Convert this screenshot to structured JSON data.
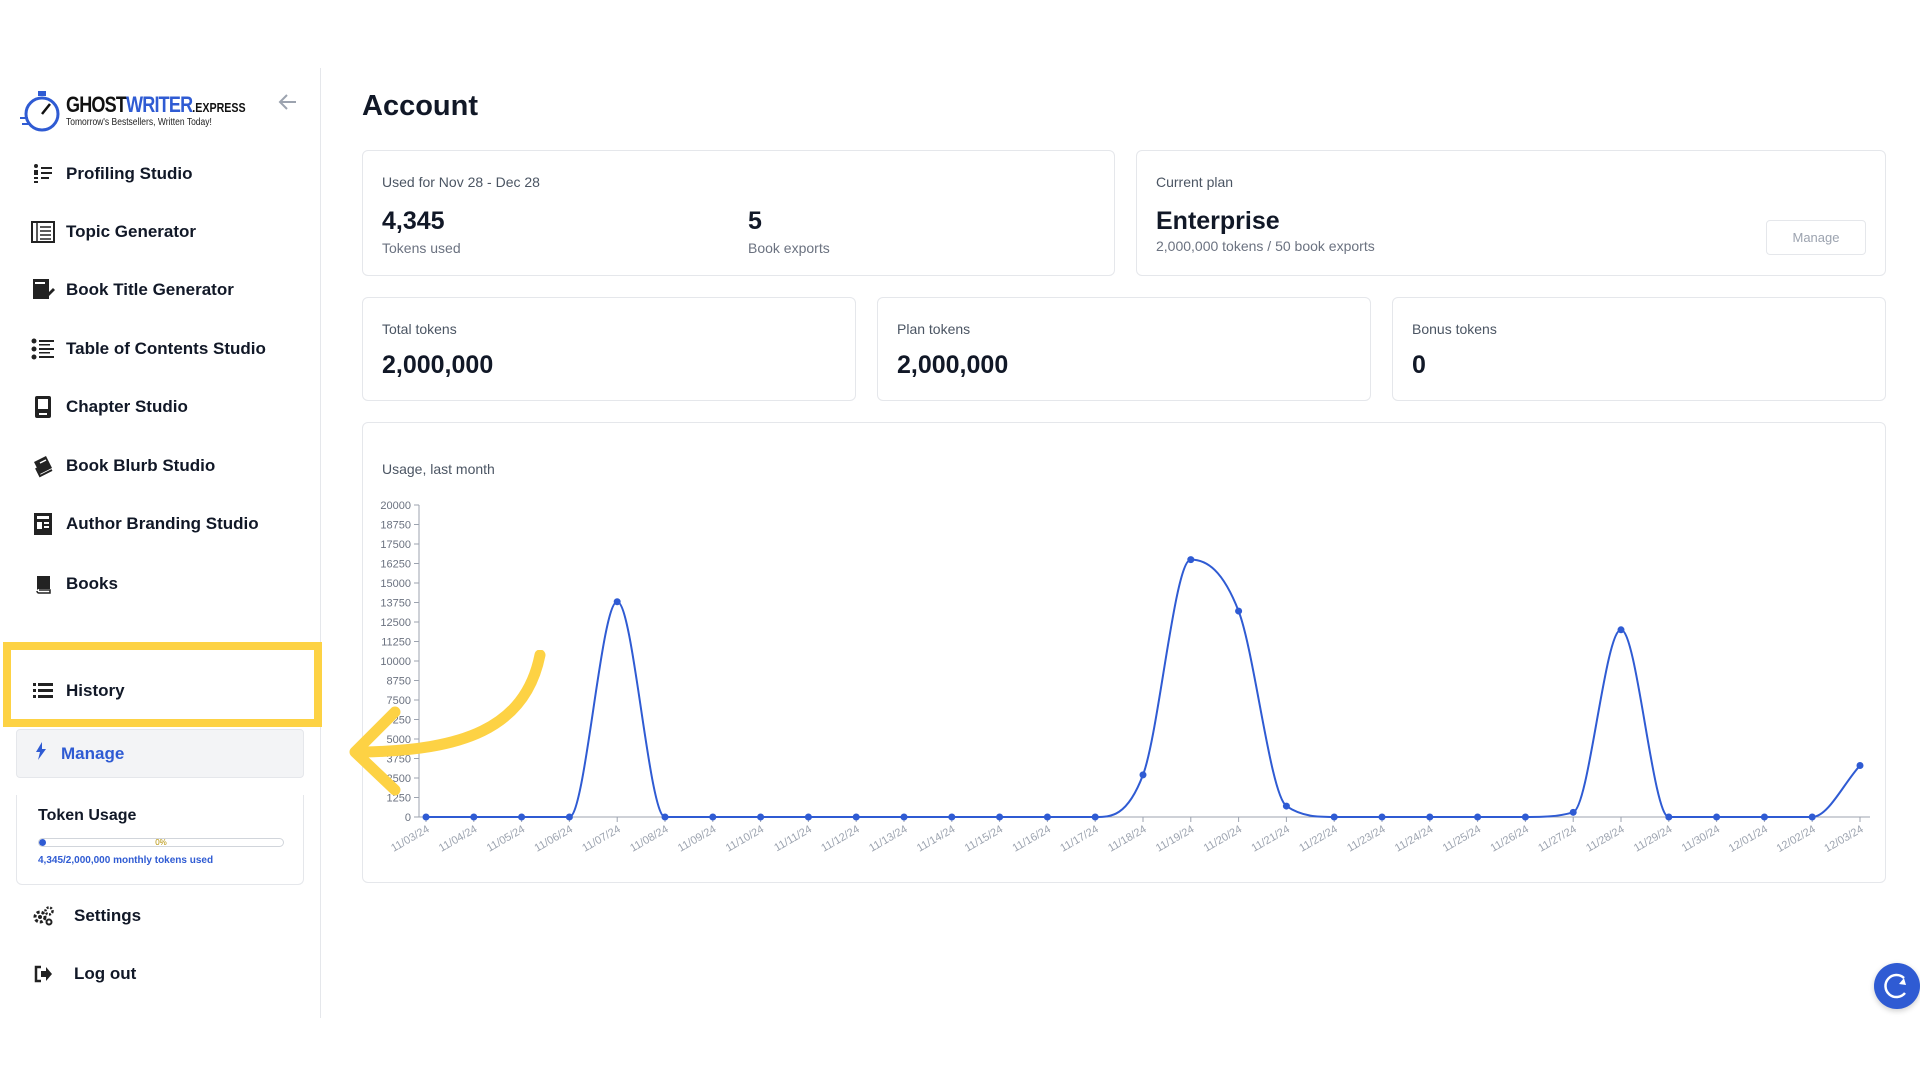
{
  "brand": {
    "name_part1": "GHOST",
    "name_part2": "WRITER",
    "name_suffix": ".EXPRESS",
    "tagline": "Tomorrow's Bestsellers, Written Today!"
  },
  "sidebar": {
    "items": [
      {
        "label": "Profiling Studio",
        "icon": "profile-list-icon"
      },
      {
        "label": "Topic Generator",
        "icon": "topic-list-icon"
      },
      {
        "label": "Book Title Generator",
        "icon": "book-edit-icon"
      },
      {
        "label": "Table of Contents Studio",
        "icon": "toc-list-icon"
      },
      {
        "label": "Chapter Studio",
        "icon": "chapter-icon"
      },
      {
        "label": "Book Blurb Studio",
        "icon": "blurb-book-icon"
      },
      {
        "label": "Author Branding Studio",
        "icon": "branding-icon"
      },
      {
        "label": "Books",
        "icon": "book-icon"
      },
      {
        "label": "History",
        "icon": "list-icon"
      },
      {
        "label": "Manage",
        "icon": "bolt-icon"
      },
      {
        "label": "Settings",
        "icon": "gears-icon"
      },
      {
        "label": "Log out",
        "icon": "logout-icon"
      }
    ],
    "token_usage": {
      "title": "Token Usage",
      "percent_label": "0%",
      "fraction": 0.002,
      "summary": "4,345/2,000,000 monthly tokens used"
    }
  },
  "main": {
    "title": "Account",
    "usage_card": {
      "caption": "Used for Nov 28 - Dec 28",
      "tokens_value": "4,345",
      "tokens_label": "Tokens used",
      "exports_value": "5",
      "exports_label": "Book exports"
    },
    "plan_card": {
      "caption": "Current plan",
      "plan_name": "Enterprise",
      "plan_detail": "2,000,000 tokens / 50 book exports",
      "manage_label": "Manage"
    },
    "total_tokens": {
      "caption": "Total tokens",
      "value": "2,000,000"
    },
    "plan_tokens": {
      "caption": "Plan tokens",
      "value": "2,000,000"
    },
    "bonus_tokens": {
      "caption": "Bonus tokens",
      "value": "0"
    },
    "chart_caption": "Usage, last month"
  },
  "colors": {
    "accent": "#2f5bd3",
    "highlight": "#fdd244"
  },
  "chart_data": {
    "type": "line",
    "x": [
      "11/03/24",
      "11/04/24",
      "11/05/24",
      "11/06/24",
      "11/07/24",
      "11/08/24",
      "11/09/24",
      "11/10/24",
      "11/11/24",
      "11/12/24",
      "11/13/24",
      "11/14/24",
      "11/15/24",
      "11/16/24",
      "11/17/24",
      "11/18/24",
      "11/19/24",
      "11/20/24",
      "11/21/24",
      "11/22/24",
      "11/23/24",
      "11/24/24",
      "11/25/24",
      "11/26/24",
      "11/27/24",
      "11/28/24",
      "11/29/24",
      "11/30/24",
      "12/01/24",
      "12/02/24",
      "12/03/24"
    ],
    "series": [
      {
        "values": [
          0,
          0,
          0,
          0,
          13800,
          0,
          0,
          0,
          0,
          0,
          0,
          0,
          0,
          0,
          0,
          2700,
          16500,
          13200,
          700,
          0,
          0,
          0,
          0,
          0,
          300,
          12000,
          0,
          0,
          0,
          0,
          3300
        ]
      }
    ],
    "yticks": [
      0,
      1250,
      2500,
      3750,
      5000,
      6250,
      7500,
      8750,
      10000,
      11250,
      12500,
      13750,
      15000,
      16250,
      17500,
      18750,
      20000
    ],
    "ylim": [
      0,
      20000
    ],
    "grid": false,
    "legend": "none"
  }
}
